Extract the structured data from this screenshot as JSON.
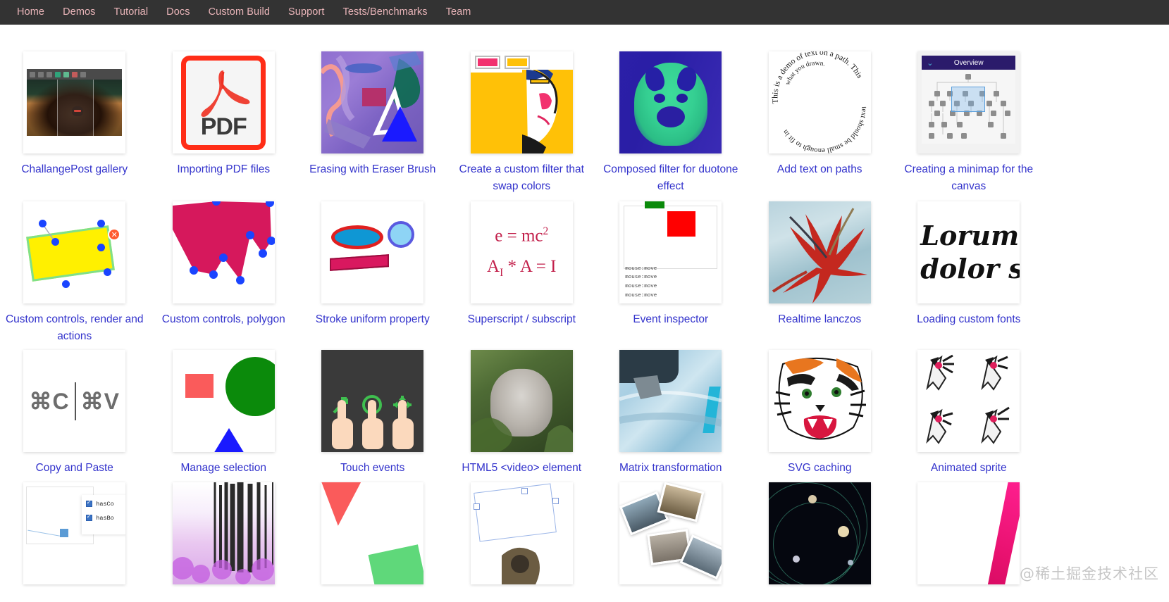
{
  "nav": {
    "items": [
      {
        "label": "Home"
      },
      {
        "label": "Demos"
      },
      {
        "label": "Tutorial"
      },
      {
        "label": "Docs"
      },
      {
        "label": "Custom Build"
      },
      {
        "label": "Support"
      },
      {
        "label": "Tests/Benchmarks"
      },
      {
        "label": "Team"
      }
    ]
  },
  "gallery": {
    "rows": [
      {
        "items": [
          {
            "caption": "ChallangePost gallery",
            "thumb": "photo-editor-screenshot"
          },
          {
            "caption": "Importing PDF files",
            "thumb": "pdf-document-icon",
            "pdf_label": "PDF"
          },
          {
            "caption": "Erasing with Eraser Brush",
            "thumb": "eraser-brush-artwork"
          },
          {
            "caption": "Create a custom filter that swap colors",
            "thumb": "color-swap-swatches"
          },
          {
            "caption": "Composed filter for duotone effect",
            "thumb": "duotone-pug-photo"
          },
          {
            "caption": "Add text on paths",
            "thumb": "spiral-text-path",
            "path_text": "This is a demo of text on a path. This text should be small enough to fit in what you drawn."
          },
          {
            "caption": "Creating a minimap for the canvas",
            "thumb": "minimap-overview",
            "panel_title": "Overview"
          }
        ]
      },
      {
        "items": [
          {
            "caption": "Custom controls, render and actions",
            "thumb": "custom-controls-rect"
          },
          {
            "caption": "Custom controls, polygon",
            "thumb": "custom-controls-polygon"
          },
          {
            "caption": "Stroke uniform property",
            "thumb": "stroke-uniform-shapes"
          },
          {
            "caption": "Superscript / subscript",
            "thumb": "math-formula",
            "formula_1": "e = mc2",
            "formula_2": "AI * A = I"
          },
          {
            "caption": "Event inspector",
            "thumb": "event-log-canvas",
            "log_lines": [
              "mouse:move",
              "mouse:move",
              "mouse:move",
              "mouse:move"
            ]
          },
          {
            "caption": "Realtime lanczos",
            "thumb": "red-dragon-painting"
          },
          {
            "caption": "Loading custom fonts",
            "thumb": "script-font-sample",
            "font_line_1": "Lorum",
            "font_line_2": "dolor s"
          }
        ]
      },
      {
        "items": [
          {
            "caption": "Copy and Paste",
            "thumb": "keyboard-shortcuts",
            "shortcut_copy": "⌘C",
            "shortcut_paste": "⌘V"
          },
          {
            "caption": "Manage selection",
            "thumb": "selection-shapes"
          },
          {
            "caption": "Touch events",
            "thumb": "touch-gesture-hands"
          },
          {
            "caption": "HTML5 <video> element",
            "thumb": "video-frame-ape"
          },
          {
            "caption": "Matrix transformation",
            "thumb": "car-photo-transform"
          },
          {
            "caption": "SVG caching",
            "thumb": "tiger-svg"
          },
          {
            "caption": "Animated sprite",
            "thumb": "bird-sprite-sheet"
          }
        ]
      },
      {
        "items": [
          {
            "caption": "",
            "thumb": "object-properties-checkboxes",
            "checkbox_1": "hasCo",
            "checkbox_2": "hasBo"
          },
          {
            "caption": "",
            "thumb": "purple-wave-pattern"
          },
          {
            "caption": "",
            "thumb": "red-green-shapes"
          },
          {
            "caption": "",
            "thumb": "freedraw-polygon-photo"
          },
          {
            "caption": "",
            "thumb": "scattered-photos"
          },
          {
            "caption": "",
            "thumb": "space-planets"
          },
          {
            "caption": "",
            "thumb": "pink-gradient-wedge"
          }
        ]
      }
    ]
  },
  "watermark": {
    "text": "@稀土掘金技术社区"
  },
  "colors": {
    "nav_background": "#333333",
    "nav_link": "#e8b4b8",
    "caption_link": "#3333cc",
    "page_background": "#ffffff"
  }
}
